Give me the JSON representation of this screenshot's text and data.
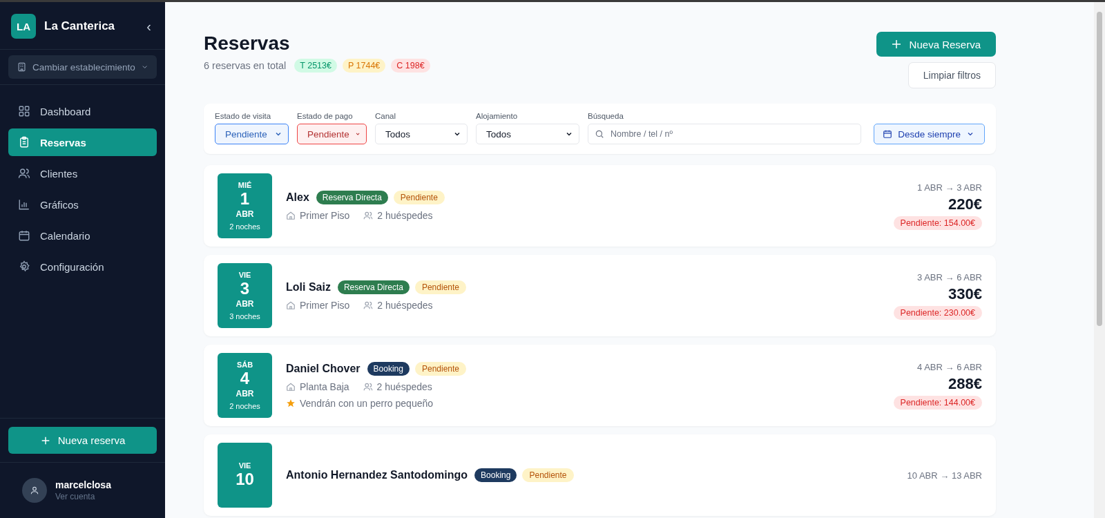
{
  "sidebar": {
    "brand": {
      "initials": "LA",
      "name": "La Canterica",
      "collapse": "‹"
    },
    "switcher": {
      "label": "Cambiar establecimiento"
    },
    "nav": [
      {
        "label": "Dashboard",
        "selected": false
      },
      {
        "label": "Reservas",
        "selected": true
      },
      {
        "label": "Clientes",
        "selected": false
      },
      {
        "label": "Gráficos",
        "selected": false
      },
      {
        "label": "Calendario",
        "selected": false
      },
      {
        "label": "Configuración",
        "selected": false
      }
    ],
    "new_button": {
      "label": "Nueva reserva"
    },
    "user": {
      "name": "marcelclosa",
      "link": "Ver cuenta"
    }
  },
  "header": {
    "title": "Reservas",
    "subtitle": "6 reservas en total",
    "totals": [
      {
        "label": "T 2513€",
        "kind": "total"
      },
      {
        "label": "P 1744€",
        "kind": "pending"
      },
      {
        "label": "C 198€",
        "kind": "charged"
      }
    ],
    "new_button": {
      "label": "Nueva Reserva"
    },
    "clear_button": {
      "label": "Limpiar filtros"
    }
  },
  "filters": [
    {
      "kind": "select",
      "label": "Estado de visita",
      "value": "Pendiente",
      "color": "#3b82f6"
    },
    {
      "kind": "select",
      "label": "Estado de pago",
      "value": "Pendiente",
      "color": "#ef4444"
    },
    {
      "kind": "select",
      "label": "Canal",
      "value": "Todos"
    },
    {
      "kind": "select",
      "label": "Alojamiento",
      "value": "Todos"
    },
    {
      "kind": "search",
      "label": "Búsqueda",
      "placeholder": "Nombre / tel / nº"
    },
    {
      "kind": "date",
      "value": "Desde siempre"
    }
  ],
  "reservations": [
    {
      "weekday": "MIÉ",
      "day": "1",
      "month": "ABR",
      "nights": "2 noches",
      "name": "Alex",
      "channel": {
        "label": "Reserva Directa",
        "kind": "direct"
      },
      "status": "Pendiente",
      "room": "Primer Piso",
      "guests": "2 huéspedes",
      "range": "1 ABR → 3 ABR",
      "price": "220€",
      "pending": "Pendiente: 154.00€"
    },
    {
      "weekday": "VIE",
      "day": "3",
      "month": "ABR",
      "nights": "3 noches",
      "name": "Loli Saiz",
      "channel": {
        "label": "Reserva Directa",
        "kind": "direct"
      },
      "status": "Pendiente",
      "room": "Primer Piso",
      "guests": "2 huéspedes",
      "range": "3 ABR → 6 ABR",
      "price": "330€",
      "pending": "Pendiente: 230.00€"
    },
    {
      "weekday": "SÁB",
      "day": "4",
      "month": "ABR",
      "nights": "2 noches",
      "name": "Daniel Chover",
      "channel": {
        "label": "Booking",
        "kind": "booking"
      },
      "status": "Pendiente",
      "room": "Planta Baja",
      "guests": "2 huéspedes",
      "note": "Vendrán con un perro pequeño",
      "range": "4 ABR → 6 ABR",
      "price": "288€",
      "pending": "Pendiente: 144.00€"
    },
    {
      "weekday": "VIE",
      "day": "10",
      "name": "Antonio Hernandez Santodomingo",
      "channel": {
        "label": "Booking",
        "kind": "booking"
      },
      "status": "Pendiente",
      "range": "10 ABR → 13 ABR"
    }
  ]
}
